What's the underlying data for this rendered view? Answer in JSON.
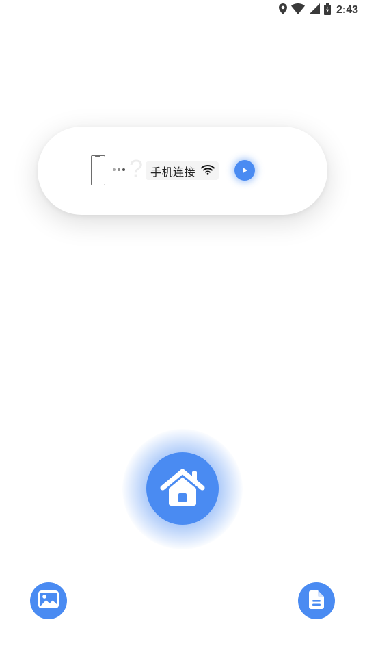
{
  "status_bar": {
    "time": "2:43",
    "icons": [
      "location-icon",
      "wifi-icon",
      "signal-icon",
      "battery-charging-icon"
    ]
  },
  "connect_card": {
    "label": "手机连接",
    "question_mark": "?",
    "icons": [
      "phone-outline-icon",
      "dots-icon",
      "wifi-icon",
      "play-icon"
    ]
  },
  "actions": {
    "home_icon": "home-icon",
    "gallery_icon": "image-icon",
    "document_icon": "document-icon"
  },
  "colors": {
    "accent": "#4a8bf2",
    "text": "#222222",
    "status_text": "#3a3a3a",
    "tag_background": "#f4f4f4",
    "dot_gray": "#9a9a9a",
    "dot_dark": "#555555"
  }
}
